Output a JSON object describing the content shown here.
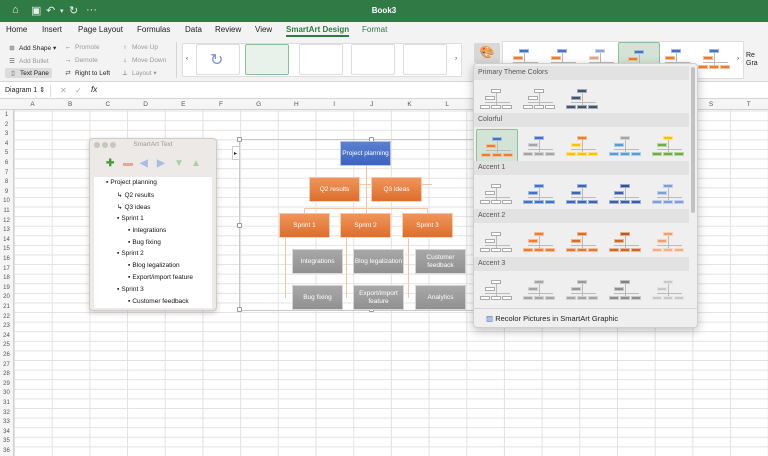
{
  "window": {
    "title": "Book3"
  },
  "quick_access": {
    "home_icon": "home-icon",
    "save_icon": "save-icon",
    "undo_icon": "undo-icon",
    "redo_icon": "redo-icon",
    "more": "···"
  },
  "tabs": [
    "Home",
    "Insert",
    "Page Layout",
    "Formulas",
    "Data",
    "Review",
    "View",
    "SmartArt Design",
    "Format"
  ],
  "active_tab": "SmartArt Design",
  "ribbon": {
    "add_shape": "Add Shape",
    "add_bullet": "Add Bullet",
    "text_pane": "Text Pane",
    "promote": "Promote",
    "demote": "Demote",
    "right_to_left": "Right to Left",
    "move_up": "Move Up",
    "move_down": "Move Down",
    "layout": "Layout",
    "reset_graphic": "Re Gra"
  },
  "formula_bar": {
    "name_box": "Diagram 1",
    "fx": "fx",
    "value": ""
  },
  "columns": [
    "A",
    "B",
    "C",
    "D",
    "E",
    "F",
    "G",
    "H",
    "I",
    "J",
    "K",
    "L",
    "M",
    "N",
    "O",
    "P",
    "Q",
    "R",
    "S",
    "T"
  ],
  "row_count": 36,
  "text_pane": {
    "title": "SmartArt Text",
    "items": [
      {
        "text": "Project planning",
        "level": 0,
        "bullet": "▪"
      },
      {
        "text": "Q2 results",
        "level": 1,
        "bullet": "↳"
      },
      {
        "text": "Q3 ideas",
        "level": 1,
        "bullet": "↳"
      },
      {
        "text": "Sprint 1",
        "level": 1,
        "bullet": "▪"
      },
      {
        "text": "Integrations",
        "level": 2,
        "bullet": "▪"
      },
      {
        "text": "Bug fixing",
        "level": 2,
        "bullet": "▪"
      },
      {
        "text": "Sprint 2",
        "level": 1,
        "bullet": "▪"
      },
      {
        "text": "Blog legalization",
        "level": 2,
        "bullet": "▪"
      },
      {
        "text": "Export/import feature",
        "level": 2,
        "bullet": "▪"
      },
      {
        "text": "Sprint 3",
        "level": 1,
        "bullet": "▪"
      },
      {
        "text": "Customer feedback",
        "level": 2,
        "bullet": "▪"
      }
    ]
  },
  "diagram": {
    "root": "Project planning",
    "assistants": [
      "Q2 results",
      "Q3 ideas"
    ],
    "sprints": [
      "Sprint 1",
      "Sprint 2",
      "Sprint 3"
    ],
    "tasks_row1": [
      "Integrations",
      "Blog legalization",
      "Customer feedback"
    ],
    "tasks_row2": [
      "Bug fixing",
      "Export/import feature",
      "Analytics"
    ]
  },
  "color_dropdown": {
    "sections": [
      {
        "label": "Primary Theme Colors",
        "variants": [
          [
            "#ffffff",
            "#ffffff",
            "#ffffff"
          ],
          [
            "#ffffff",
            "#ffffff",
            "#ffffff"
          ],
          [
            "#44546a",
            "#44546a",
            "#44546a"
          ]
        ]
      },
      {
        "label": "Colorful",
        "variants": [
          [
            "#4472c4",
            "#ed7d31",
            "#ed7d31"
          ],
          [
            "#4472c4",
            "#a5a5a5",
            "#a5a5a5"
          ],
          [
            "#ed7d31",
            "#ffc000",
            "#ffc000"
          ],
          [
            "#a5a5a5",
            "#5b9bd5",
            "#5b9bd5"
          ],
          [
            "#ffc000",
            "#70ad47",
            "#70ad47"
          ]
        ],
        "selected": 0
      },
      {
        "label": "Accent 1",
        "variants": [
          [
            "#ffffff",
            "#ffffff",
            "#ffffff"
          ],
          [
            "#4472c4",
            "#4472c4",
            "#4472c4"
          ],
          [
            "#3c66b4",
            "#3c66b4",
            "#3c66b4"
          ],
          [
            "#2f5597",
            "#3a5ea8",
            "#3a5ea8"
          ],
          [
            "#7f9fdb",
            "#7f9fdb",
            "#7f9fdb"
          ]
        ]
      },
      {
        "label": "Accent 2",
        "variants": [
          [
            "#ffffff",
            "#ffffff",
            "#ffffff"
          ],
          [
            "#ed7d31",
            "#ed7d31",
            "#ed7d31"
          ],
          [
            "#d96c26",
            "#d96c26",
            "#e07a38"
          ],
          [
            "#b85a1f",
            "#cc6a2a",
            "#cc6a2a"
          ],
          [
            "#f0a06a",
            "#f0a06a",
            "#f0b088"
          ]
        ]
      },
      {
        "label": "Accent 3",
        "variants": [
          [
            "#ffffff",
            "#ffffff",
            "#ffffff"
          ],
          [
            "#a5a5a5",
            "#a5a5a5",
            "#a5a5a5"
          ],
          [
            "#999999",
            "#999999",
            "#a5a5a5"
          ],
          [
            "#7f7f7f",
            "#8f8f8f",
            "#8f8f8f"
          ],
          [
            "#c9c9c9",
            "#c9c9c9",
            "#c9c9c9"
          ]
        ]
      }
    ],
    "recolor_label": "Recolor Pictures in SmartArt Graphic"
  },
  "colors": {
    "brand_green": "#2f7a45",
    "node_blue": "#4472c4",
    "node_orange": "#ed7d31",
    "node_gray": "#a5a5a5"
  }
}
